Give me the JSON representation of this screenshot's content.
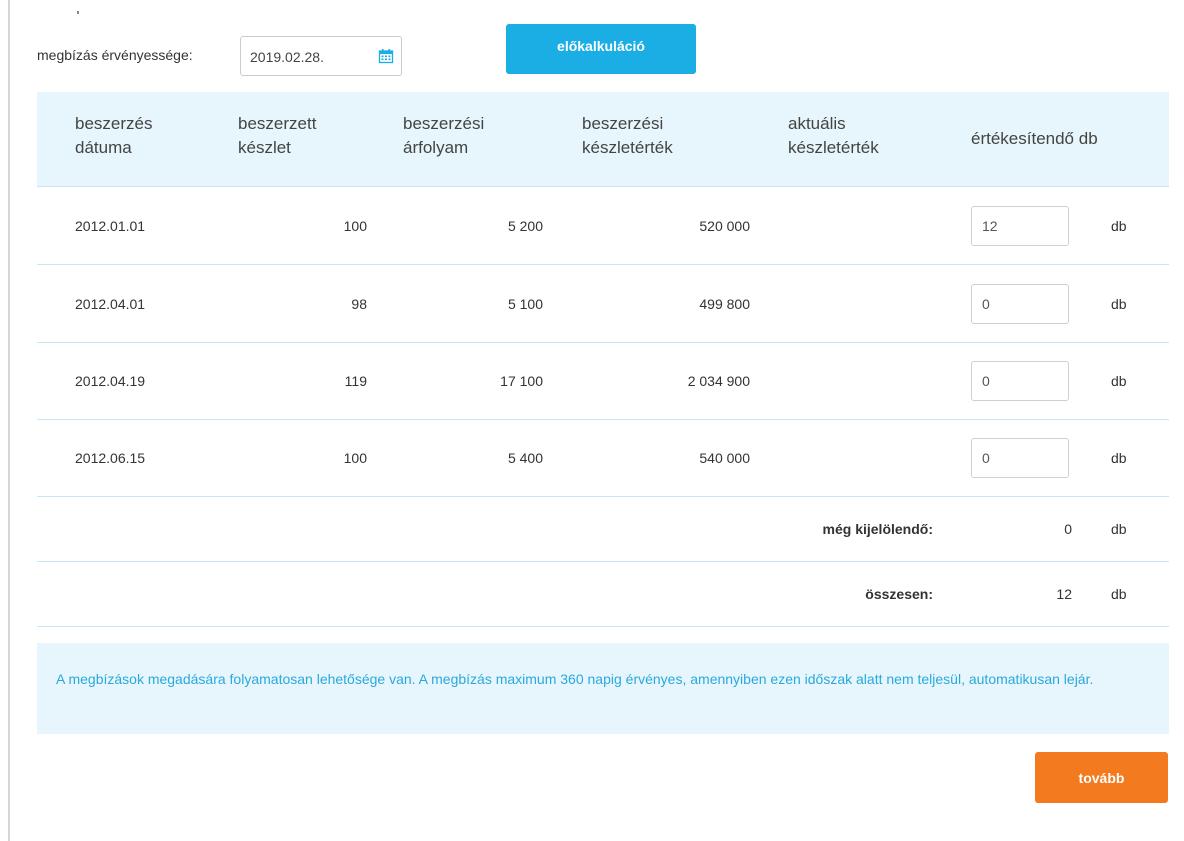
{
  "validity": {
    "label": "megbízás érvényessége:",
    "date_value": "2019.02.28.",
    "icon": "calendar-icon"
  },
  "precalc_button": {
    "label": "előkalkuláció",
    "color": "#1aaee5"
  },
  "table": {
    "headers": [
      {
        "line1": "beszerzés",
        "line2": "dátuma"
      },
      {
        "line1": "beszerzett",
        "line2": "készlet"
      },
      {
        "line1": "beszerzési",
        "line2": "árfolyam"
      },
      {
        "line1": "beszerzési",
        "line2": "készletérték"
      },
      {
        "line1": "aktuális",
        "line2": "készletérték"
      },
      {
        "line1": "értékesítendő db",
        "line2": ""
      }
    ],
    "rows": [
      {
        "date": "2012.01.01",
        "stock": "100",
        "rate": "5 200",
        "value": "520 000",
        "current": "",
        "qty": "12",
        "unit": "db"
      },
      {
        "date": "2012.04.01",
        "stock": "98",
        "rate": "5 100",
        "value": "499 800",
        "current": "",
        "qty": "0",
        "unit": "db"
      },
      {
        "date": "2012.04.19",
        "stock": "119",
        "rate": "17 100",
        "value": "2 034 900",
        "current": "",
        "qty": "0",
        "unit": "db"
      },
      {
        "date": "2012.06.15",
        "stock": "100",
        "rate": "5 400",
        "value": "540 000",
        "current": "",
        "qty": "0",
        "unit": "db"
      }
    ],
    "remaining": {
      "label": "még kijelölendő:",
      "value": "0",
      "unit": "db"
    },
    "total": {
      "label": "összesen:",
      "value": "12",
      "unit": "db"
    }
  },
  "info_text": "A megbízások megadására folyamatosan lehetősége van. A megbízás maximum 360 napig érvényes, amennyiben ezen időszak alatt nem teljesül, automatikusan lejár.",
  "next_button": {
    "label": "tovább",
    "color": "#f47a1f"
  }
}
